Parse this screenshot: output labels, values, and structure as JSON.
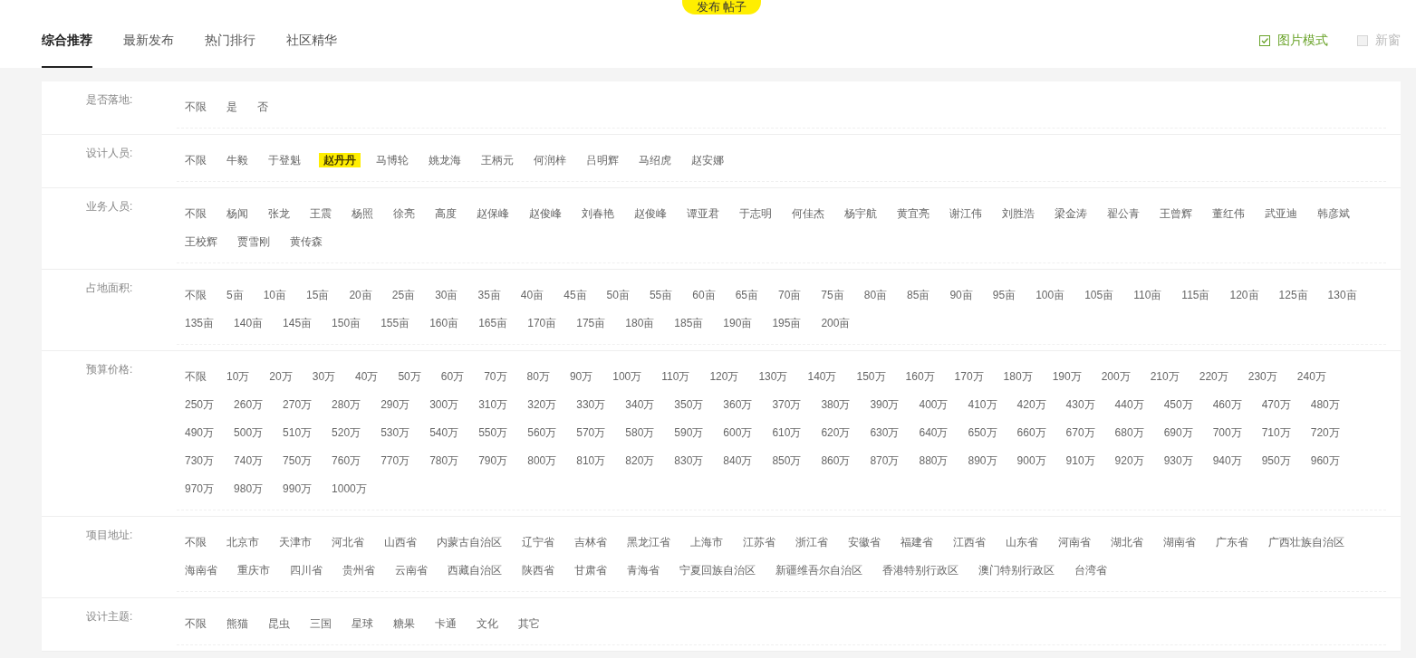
{
  "publish_button": {
    "label": "发布 帖子"
  },
  "tabs": [
    {
      "label": "综合推荐",
      "selected": true
    },
    {
      "label": "最新发布",
      "selected": false
    },
    {
      "label": "热门排行",
      "selected": false
    },
    {
      "label": "社区精华",
      "selected": false
    }
  ],
  "view_options": [
    {
      "label": "图片模式",
      "checked": true
    },
    {
      "label": "新窗",
      "checked": false
    }
  ],
  "filters": [
    {
      "label": "是否落地:",
      "options": [
        {
          "label": "不限",
          "selected": false
        },
        {
          "label": "是",
          "selected": false
        },
        {
          "label": "否",
          "selected": false
        }
      ]
    },
    {
      "label": "设计人员:",
      "options": [
        {
          "label": "不限",
          "selected": false
        },
        {
          "label": "牛毅",
          "selected": false
        },
        {
          "label": "于登魁",
          "selected": false
        },
        {
          "label": "赵丹丹",
          "selected": true
        },
        {
          "label": "马博轮",
          "selected": false
        },
        {
          "label": "姚龙海",
          "selected": false
        },
        {
          "label": "王柄元",
          "selected": false
        },
        {
          "label": "何润梓",
          "selected": false
        },
        {
          "label": "吕明辉",
          "selected": false
        },
        {
          "label": "马绍虎",
          "selected": false
        },
        {
          "label": "赵安娜",
          "selected": false
        }
      ]
    },
    {
      "label": "业务人员:",
      "options": [
        {
          "label": "不限",
          "selected": false
        },
        {
          "label": "杨闻",
          "selected": false
        },
        {
          "label": "张龙",
          "selected": false
        },
        {
          "label": "王震",
          "selected": false
        },
        {
          "label": "杨照",
          "selected": false
        },
        {
          "label": "徐亮",
          "selected": false
        },
        {
          "label": "高度",
          "selected": false
        },
        {
          "label": "赵保峰",
          "selected": false
        },
        {
          "label": "赵俊峰",
          "selected": false
        },
        {
          "label": "刘春艳",
          "selected": false
        },
        {
          "label": "赵俊峰",
          "selected": false
        },
        {
          "label": "谭亚君",
          "selected": false
        },
        {
          "label": "于志明",
          "selected": false
        },
        {
          "label": "何佳杰",
          "selected": false
        },
        {
          "label": "杨宇航",
          "selected": false
        },
        {
          "label": "黄宜亮",
          "selected": false
        },
        {
          "label": "谢江伟",
          "selected": false
        },
        {
          "label": "刘胜浩",
          "selected": false
        },
        {
          "label": "梁金涛",
          "selected": false
        },
        {
          "label": "翟公青",
          "selected": false
        },
        {
          "label": "王曾辉",
          "selected": false
        },
        {
          "label": "董红伟",
          "selected": false
        },
        {
          "label": "武亚迪",
          "selected": false
        },
        {
          "label": "韩彦斌",
          "selected": false
        },
        {
          "label": "王校辉",
          "selected": false
        },
        {
          "label": "贾雪刚",
          "selected": false
        },
        {
          "label": "黄传森",
          "selected": false
        }
      ]
    },
    {
      "label": "占地面积:",
      "options": [
        {
          "label": "不限",
          "selected": false
        },
        {
          "label": "5亩",
          "selected": false
        },
        {
          "label": "10亩",
          "selected": false
        },
        {
          "label": "15亩",
          "selected": false
        },
        {
          "label": "20亩",
          "selected": false
        },
        {
          "label": "25亩",
          "selected": false
        },
        {
          "label": "30亩",
          "selected": false
        },
        {
          "label": "35亩",
          "selected": false
        },
        {
          "label": "40亩",
          "selected": false
        },
        {
          "label": "45亩",
          "selected": false
        },
        {
          "label": "50亩",
          "selected": false
        },
        {
          "label": "55亩",
          "selected": false
        },
        {
          "label": "60亩",
          "selected": false
        },
        {
          "label": "65亩",
          "selected": false
        },
        {
          "label": "70亩",
          "selected": false
        },
        {
          "label": "75亩",
          "selected": false
        },
        {
          "label": "80亩",
          "selected": false
        },
        {
          "label": "85亩",
          "selected": false
        },
        {
          "label": "90亩",
          "selected": false
        },
        {
          "label": "95亩",
          "selected": false
        },
        {
          "label": "100亩",
          "selected": false
        },
        {
          "label": "105亩",
          "selected": false
        },
        {
          "label": "110亩",
          "selected": false
        },
        {
          "label": "115亩",
          "selected": false
        },
        {
          "label": "120亩",
          "selected": false
        },
        {
          "label": "125亩",
          "selected": false
        },
        {
          "label": "130亩",
          "selected": false
        },
        {
          "label": "135亩",
          "selected": false
        },
        {
          "label": "140亩",
          "selected": false
        },
        {
          "label": "145亩",
          "selected": false
        },
        {
          "label": "150亩",
          "selected": false
        },
        {
          "label": "155亩",
          "selected": false
        },
        {
          "label": "160亩",
          "selected": false
        },
        {
          "label": "165亩",
          "selected": false
        },
        {
          "label": "170亩",
          "selected": false
        },
        {
          "label": "175亩",
          "selected": false
        },
        {
          "label": "180亩",
          "selected": false
        },
        {
          "label": "185亩",
          "selected": false
        },
        {
          "label": "190亩",
          "selected": false
        },
        {
          "label": "195亩",
          "selected": false
        },
        {
          "label": "200亩",
          "selected": false
        }
      ]
    },
    {
      "label": "预算价格:",
      "options": [
        {
          "label": "不限",
          "selected": false
        },
        {
          "label": "10万",
          "selected": false
        },
        {
          "label": "20万",
          "selected": false
        },
        {
          "label": "30万",
          "selected": false
        },
        {
          "label": "40万",
          "selected": false
        },
        {
          "label": "50万",
          "selected": false
        },
        {
          "label": "60万",
          "selected": false
        },
        {
          "label": "70万",
          "selected": false
        },
        {
          "label": "80万",
          "selected": false
        },
        {
          "label": "90万",
          "selected": false
        },
        {
          "label": "100万",
          "selected": false
        },
        {
          "label": "110万",
          "selected": false
        },
        {
          "label": "120万",
          "selected": false
        },
        {
          "label": "130万",
          "selected": false
        },
        {
          "label": "140万",
          "selected": false
        },
        {
          "label": "150万",
          "selected": false
        },
        {
          "label": "160万",
          "selected": false
        },
        {
          "label": "170万",
          "selected": false
        },
        {
          "label": "180万",
          "selected": false
        },
        {
          "label": "190万",
          "selected": false
        },
        {
          "label": "200万",
          "selected": false
        },
        {
          "label": "210万",
          "selected": false
        },
        {
          "label": "220万",
          "selected": false
        },
        {
          "label": "230万",
          "selected": false
        },
        {
          "label": "240万",
          "selected": false
        },
        {
          "label": "250万",
          "selected": false
        },
        {
          "label": "260万",
          "selected": false
        },
        {
          "label": "270万",
          "selected": false
        },
        {
          "label": "280万",
          "selected": false
        },
        {
          "label": "290万",
          "selected": false
        },
        {
          "label": "300万",
          "selected": false
        },
        {
          "label": "310万",
          "selected": false
        },
        {
          "label": "320万",
          "selected": false
        },
        {
          "label": "330万",
          "selected": false
        },
        {
          "label": "340万",
          "selected": false
        },
        {
          "label": "350万",
          "selected": false
        },
        {
          "label": "360万",
          "selected": false
        },
        {
          "label": "370万",
          "selected": false
        },
        {
          "label": "380万",
          "selected": false
        },
        {
          "label": "390万",
          "selected": false
        },
        {
          "label": "400万",
          "selected": false
        },
        {
          "label": "410万",
          "selected": false
        },
        {
          "label": "420万",
          "selected": false
        },
        {
          "label": "430万",
          "selected": false
        },
        {
          "label": "440万",
          "selected": false
        },
        {
          "label": "450万",
          "selected": false
        },
        {
          "label": "460万",
          "selected": false
        },
        {
          "label": "470万",
          "selected": false
        },
        {
          "label": "480万",
          "selected": false
        },
        {
          "label": "490万",
          "selected": false
        },
        {
          "label": "500万",
          "selected": false
        },
        {
          "label": "510万",
          "selected": false
        },
        {
          "label": "520万",
          "selected": false
        },
        {
          "label": "530万",
          "selected": false
        },
        {
          "label": "540万",
          "selected": false
        },
        {
          "label": "550万",
          "selected": false
        },
        {
          "label": "560万",
          "selected": false
        },
        {
          "label": "570万",
          "selected": false
        },
        {
          "label": "580万",
          "selected": false
        },
        {
          "label": "590万",
          "selected": false
        },
        {
          "label": "600万",
          "selected": false
        },
        {
          "label": "610万",
          "selected": false
        },
        {
          "label": "620万",
          "selected": false
        },
        {
          "label": "630万",
          "selected": false
        },
        {
          "label": "640万",
          "selected": false
        },
        {
          "label": "650万",
          "selected": false
        },
        {
          "label": "660万",
          "selected": false
        },
        {
          "label": "670万",
          "selected": false
        },
        {
          "label": "680万",
          "selected": false
        },
        {
          "label": "690万",
          "selected": false
        },
        {
          "label": "700万",
          "selected": false
        },
        {
          "label": "710万",
          "selected": false
        },
        {
          "label": "720万",
          "selected": false
        },
        {
          "label": "730万",
          "selected": false
        },
        {
          "label": "740万",
          "selected": false
        },
        {
          "label": "750万",
          "selected": false
        },
        {
          "label": "760万",
          "selected": false
        },
        {
          "label": "770万",
          "selected": false
        },
        {
          "label": "780万",
          "selected": false
        },
        {
          "label": "790万",
          "selected": false
        },
        {
          "label": "800万",
          "selected": false
        },
        {
          "label": "810万",
          "selected": false
        },
        {
          "label": "820万",
          "selected": false
        },
        {
          "label": "830万",
          "selected": false
        },
        {
          "label": "840万",
          "selected": false
        },
        {
          "label": "850万",
          "selected": false
        },
        {
          "label": "860万",
          "selected": false
        },
        {
          "label": "870万",
          "selected": false
        },
        {
          "label": "880万",
          "selected": false
        },
        {
          "label": "890万",
          "selected": false
        },
        {
          "label": "900万",
          "selected": false
        },
        {
          "label": "910万",
          "selected": false
        },
        {
          "label": "920万",
          "selected": false
        },
        {
          "label": "930万",
          "selected": false
        },
        {
          "label": "940万",
          "selected": false
        },
        {
          "label": "950万",
          "selected": false
        },
        {
          "label": "960万",
          "selected": false
        },
        {
          "label": "970万",
          "selected": false
        },
        {
          "label": "980万",
          "selected": false
        },
        {
          "label": "990万",
          "selected": false
        },
        {
          "label": "1000万",
          "selected": false
        }
      ]
    },
    {
      "label": "项目地址:",
      "options": [
        {
          "label": "不限",
          "selected": false
        },
        {
          "label": "北京市",
          "selected": false
        },
        {
          "label": "天津市",
          "selected": false
        },
        {
          "label": "河北省",
          "selected": false
        },
        {
          "label": "山西省",
          "selected": false
        },
        {
          "label": "内蒙古自治区",
          "selected": false
        },
        {
          "label": "辽宁省",
          "selected": false
        },
        {
          "label": "吉林省",
          "selected": false
        },
        {
          "label": "黑龙江省",
          "selected": false
        },
        {
          "label": "上海市",
          "selected": false
        },
        {
          "label": "江苏省",
          "selected": false
        },
        {
          "label": "浙江省",
          "selected": false
        },
        {
          "label": "安徽省",
          "selected": false
        },
        {
          "label": "福建省",
          "selected": false
        },
        {
          "label": "江西省",
          "selected": false
        },
        {
          "label": "山东省",
          "selected": false
        },
        {
          "label": "河南省",
          "selected": false
        },
        {
          "label": "湖北省",
          "selected": false
        },
        {
          "label": "湖南省",
          "selected": false
        },
        {
          "label": "广东省",
          "selected": false
        },
        {
          "label": "广西壮族自治区",
          "selected": false
        },
        {
          "label": "海南省",
          "selected": false
        },
        {
          "label": "重庆市",
          "selected": false
        },
        {
          "label": "四川省",
          "selected": false
        },
        {
          "label": "贵州省",
          "selected": false
        },
        {
          "label": "云南省",
          "selected": false
        },
        {
          "label": "西藏自治区",
          "selected": false
        },
        {
          "label": "陕西省",
          "selected": false
        },
        {
          "label": "甘肃省",
          "selected": false
        },
        {
          "label": "青海省",
          "selected": false
        },
        {
          "label": "宁夏回族自治区",
          "selected": false
        },
        {
          "label": "新疆维吾尔自治区",
          "selected": false
        },
        {
          "label": "香港特别行政区",
          "selected": false
        },
        {
          "label": "澳门特别行政区",
          "selected": false
        },
        {
          "label": "台湾省",
          "selected": false
        }
      ]
    },
    {
      "label": "设计主题:",
      "options": [
        {
          "label": "不限",
          "selected": false
        },
        {
          "label": "熊猫",
          "selected": false
        },
        {
          "label": "昆虫",
          "selected": false
        },
        {
          "label": "三国",
          "selected": false
        },
        {
          "label": "星球",
          "selected": false
        },
        {
          "label": "糖果",
          "selected": false
        },
        {
          "label": "卡通",
          "selected": false
        },
        {
          "label": "文化",
          "selected": false
        },
        {
          "label": "其它",
          "selected": false
        }
      ]
    }
  ]
}
